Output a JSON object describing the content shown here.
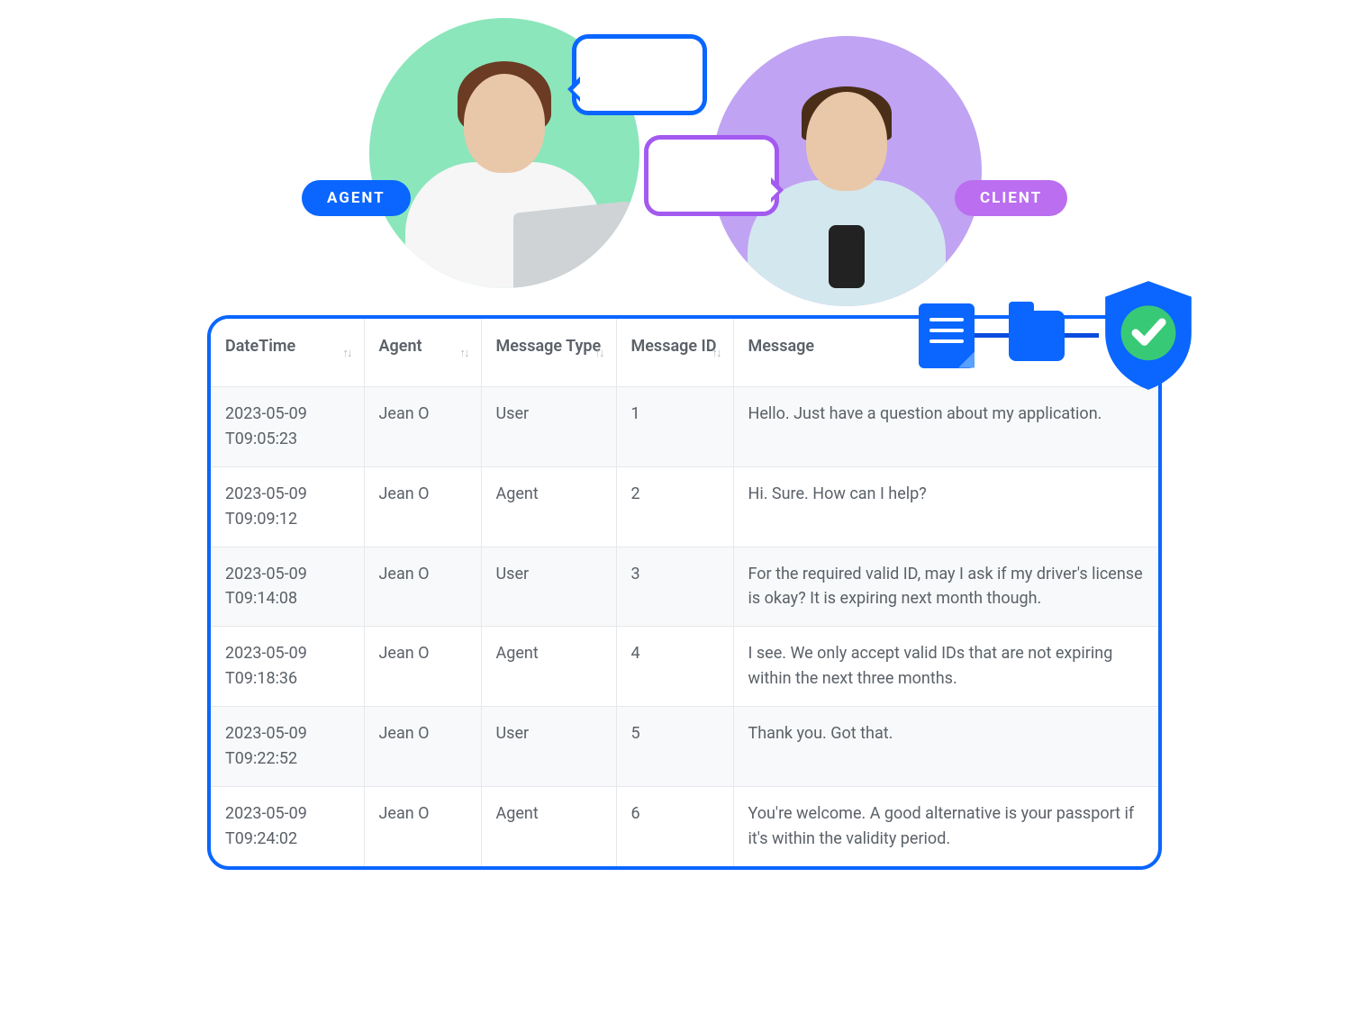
{
  "hero": {
    "agent_label": "AGENT",
    "client_label": "CLIENT"
  },
  "icons": {
    "document": "document-icon",
    "folder": "folder-icon",
    "shield": "shield-check-icon"
  },
  "table": {
    "columns": {
      "datetime": "DateTime",
      "agent": "Agent",
      "message_type": "Message Type",
      "message_id": "Message ID",
      "message": "Message"
    },
    "rows": [
      {
        "datetime": "2023-05-09 T09:05:23",
        "agent": "Jean O",
        "message_type": "User",
        "message_id": "1",
        "message": "Hello. Just have a question about my application."
      },
      {
        "datetime": "2023-05-09 T09:09:12",
        "agent": "Jean O",
        "message_type": "Agent",
        "message_id": "2",
        "message": "Hi. Sure. How can I help?"
      },
      {
        "datetime": "2023-05-09 T09:14:08",
        "agent": "Jean O",
        "message_type": "User",
        "message_id": "3",
        "message": "For the required valid ID, may I ask if my driver's license is okay? It is expiring next month though."
      },
      {
        "datetime": "2023-05-09 T09:18:36",
        "agent": "Jean O",
        "message_type": "Agent",
        "message_id": "4",
        "message": "I see. We only accept valid IDs that are not expiring within the next three months."
      },
      {
        "datetime": "2023-05-09 T09:22:52",
        "agent": "Jean O",
        "message_type": "User",
        "message_id": "5",
        "message": "Thank you. Got that."
      },
      {
        "datetime": "2023-05-09 T09:24:02",
        "agent": "Jean O",
        "message_type": "Agent",
        "message_id": "6",
        "message": "You're welcome. A good alternative is your passport if it's within the validity period."
      }
    ]
  },
  "colors": {
    "accent_blue": "#0a66ff",
    "accent_purple": "#bb6ef0",
    "avatar_green": "#8be6bb",
    "avatar_lilac": "#c0a3f3",
    "check_green": "#38c976"
  }
}
